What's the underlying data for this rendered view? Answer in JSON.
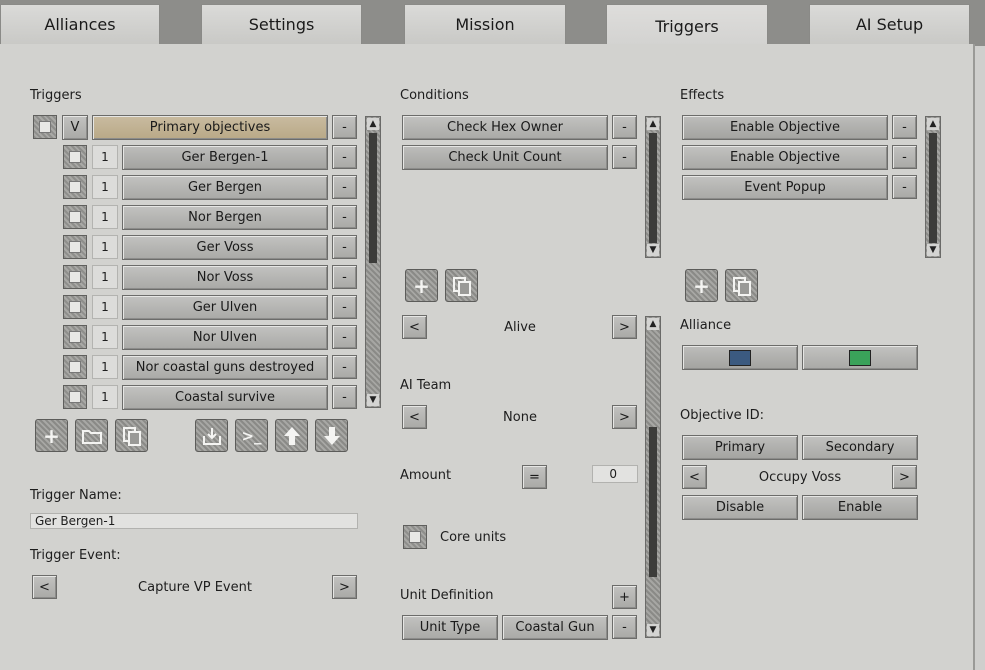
{
  "tabs": [
    "Alliances",
    "Settings",
    "Mission",
    "Triggers",
    "AI Setup"
  ],
  "triggers": {
    "heading": "Triggers",
    "header_btn": "V",
    "group_label": "Primary objectives",
    "items": [
      {
        "num": "1",
        "label": "Ger Bergen-1"
      },
      {
        "num": "1",
        "label": "Ger Bergen"
      },
      {
        "num": "1",
        "label": "Nor Bergen"
      },
      {
        "num": "1",
        "label": "Ger Voss"
      },
      {
        "num": "1",
        "label": "Nor Voss"
      },
      {
        "num": "1",
        "label": "Ger Ulven"
      },
      {
        "num": "1",
        "label": "Nor Ulven"
      },
      {
        "num": "1",
        "label": "Nor coastal guns destroyed"
      },
      {
        "num": "1",
        "label": "Coastal survive"
      }
    ],
    "remove": "-",
    "name_label": "Trigger Name:",
    "name_value": "Ger Bergen-1",
    "event_label": "Trigger Event:",
    "event_value": "Capture VP Event",
    "prev": "<",
    "next": ">"
  },
  "conditions": {
    "heading": "Conditions",
    "items": [
      "Check Hex Owner",
      "Check Unit Count"
    ],
    "remove": "-",
    "alive_value": "Alive",
    "ai_team_label": "AI Team",
    "ai_team_value": "None",
    "amount_label": "Amount",
    "amount_op": "=",
    "amount_value": "0",
    "core_units_label": "Core units",
    "unit_def_label": "Unit Definition",
    "unit_def_add": "+",
    "unit_type_btn": "Unit Type",
    "unit_type_value": "Coastal Gun",
    "prev": "<",
    "next": ">"
  },
  "effects": {
    "heading": "Effects",
    "items": [
      "Enable Objective",
      "Enable Objective",
      "Event Popup"
    ],
    "remove": "-",
    "alliance_label": "Alliance",
    "alliance_colors": [
      "#3b5a80",
      "#3aa25a"
    ],
    "objective_id_label": "Objective ID:",
    "primary_btn": "Primary",
    "secondary_btn": "Secondary",
    "objective_value": "Occupy Voss",
    "disable_btn": "Disable",
    "enable_btn": "Enable",
    "prev": "<",
    "next": ">"
  },
  "icons": {
    "add": "+",
    "folder": "folder-icon",
    "copy": "copy-icon",
    "import": "import-icon",
    "console": ">_",
    "up": "arrow-up-icon",
    "down": "arrow-down-icon"
  }
}
